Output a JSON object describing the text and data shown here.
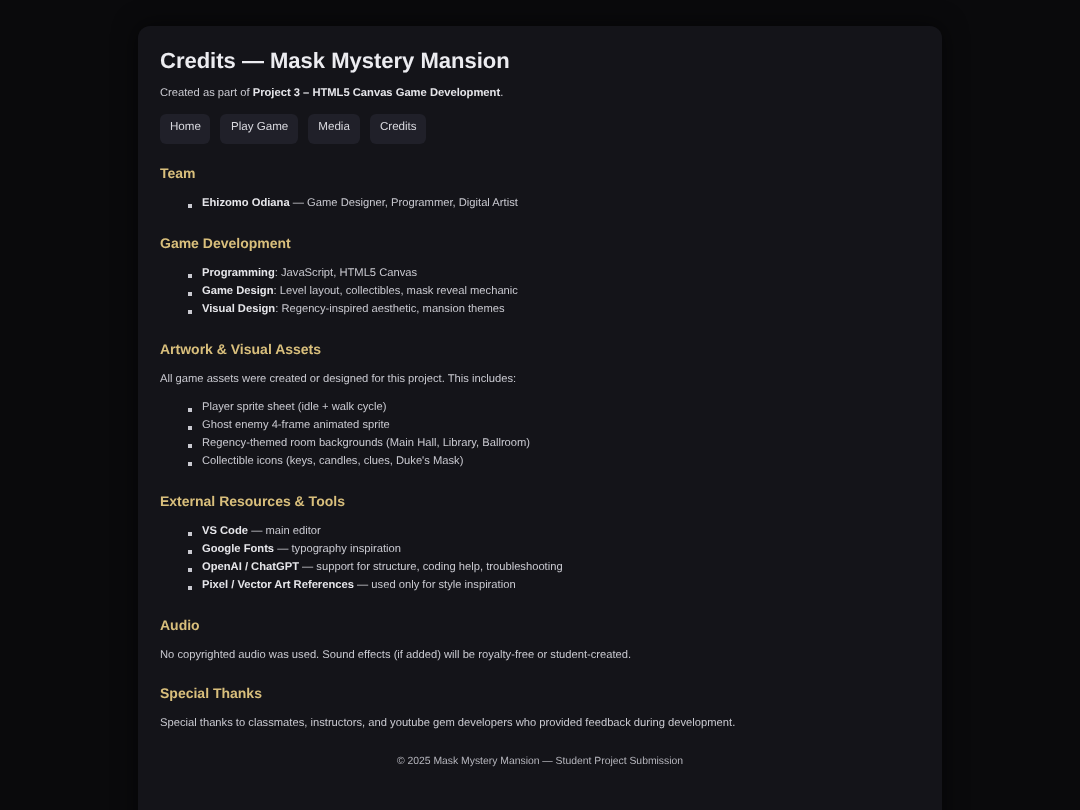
{
  "title": "Credits — Mask Mystery Mansion",
  "subtitle": "Created as part of **Project 3 – HTML5 Canvas Game Development**.",
  "nav": [
    {
      "label": "Home"
    },
    {
      "label": "Play Game"
    },
    {
      "label": "Media"
    },
    {
      "label": "Credits"
    }
  ],
  "sections": [
    {
      "heading": "Team",
      "items": [
        "**Ehizomo Odiana** — Game Designer, Programmer, Digital Artist"
      ]
    },
    {
      "heading": "Game Development",
      "items": [
        "**Programming**: JavaScript, HTML5 Canvas",
        "**Game Design**: Level layout, collectibles, mask reveal mechanic",
        "**Visual Design**: Regency-inspired aesthetic, mansion themes"
      ]
    },
    {
      "heading": "Artwork & Visual Assets",
      "text": "All game assets were created or designed for this project. This includes:",
      "items": [
        "Player sprite sheet (idle + walk cycle)",
        "Ghost enemy 4-frame animated sprite",
        "Regency-themed room backgrounds (Main Hall, Library, Ballroom)",
        "Collectible icons (keys, candles, clues, Duke's Mask)"
      ]
    },
    {
      "heading": "External Resources & Tools",
      "items": [
        "**VS Code** — main editor",
        "**Google Fonts** — typography inspiration",
        "**OpenAI / ChatGPT** — support for structure, coding help, troubleshooting",
        "**Pixel / Vector Art References** — used only for style inspiration"
      ]
    },
    {
      "heading": "Audio",
      "text": "No copyrighted audio was used. Sound effects (if added) will be royalty-free or student-created."
    },
    {
      "heading": "Special Thanks",
      "text": "Special thanks to classmates, instructors, and youtube gem developers who provided feedback during development."
    }
  ],
  "footer": "© 2025 Mask Mystery Mansion — Student Project Submission"
}
